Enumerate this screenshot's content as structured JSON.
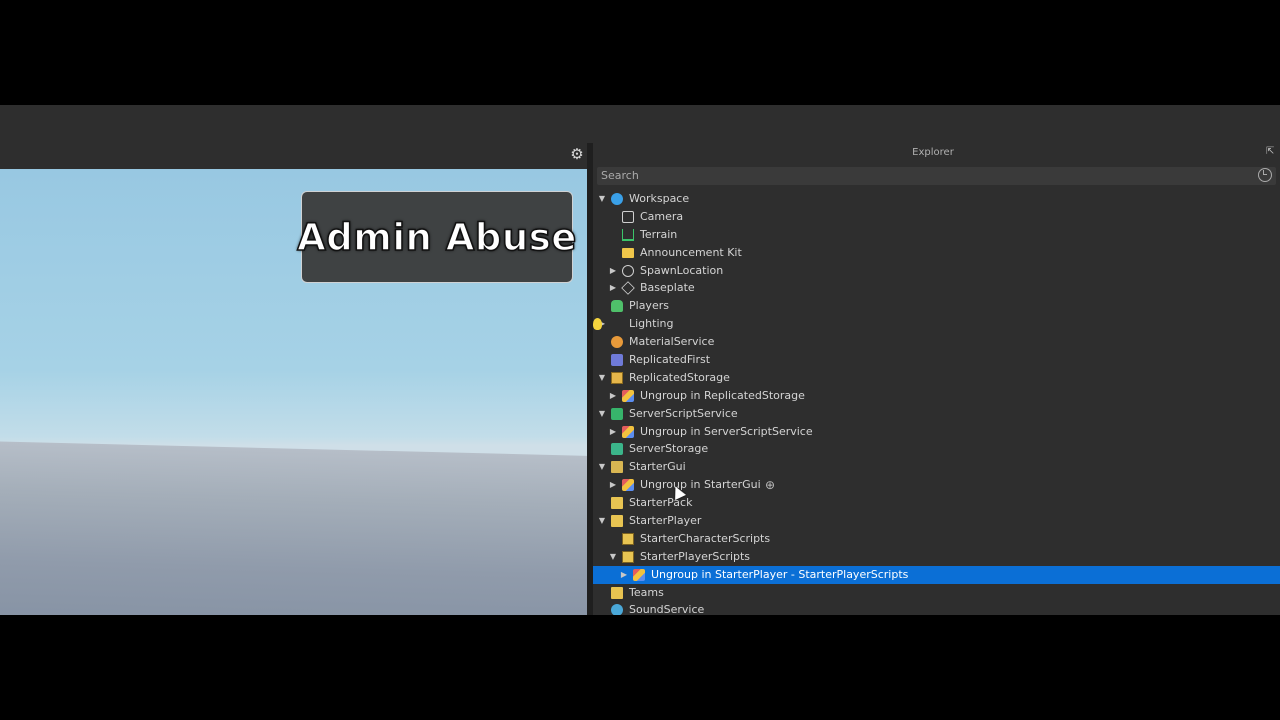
{
  "viewport": {
    "gui_text": "Admin Abuse",
    "settings_icon": "gear-icon"
  },
  "explorer": {
    "title": "Explorer",
    "search_placeholder": "Search",
    "items": [
      {
        "label": "Workspace",
        "depth": 0,
        "expanded": true,
        "icon": "workspace-icon"
      },
      {
        "label": "Camera",
        "depth": 1,
        "icon": "camera-icon"
      },
      {
        "label": "Terrain",
        "depth": 1,
        "icon": "terrain-icon"
      },
      {
        "label": "Announcement Kit",
        "depth": 1,
        "icon": "folder-icon"
      },
      {
        "label": "SpawnLocation",
        "depth": 1,
        "collapsed": true,
        "icon": "spawn-icon"
      },
      {
        "label": "Baseplate",
        "depth": 1,
        "collapsed": true,
        "icon": "part-icon"
      },
      {
        "label": "Players",
        "depth": 0,
        "icon": "players-icon"
      },
      {
        "label": "Lighting",
        "depth": 0,
        "collapsed": true,
        "icon": "lighting-icon"
      },
      {
        "label": "MaterialService",
        "depth": 0,
        "icon": "material-service-icon"
      },
      {
        "label": "ReplicatedFirst",
        "depth": 0,
        "icon": "replicated-first-icon"
      },
      {
        "label": "ReplicatedStorage",
        "depth": 0,
        "expanded": true,
        "icon": "replicated-storage-icon"
      },
      {
        "label": "Ungroup in ReplicatedStorage",
        "depth": 1,
        "collapsed": true,
        "icon": "model-icon"
      },
      {
        "label": "ServerScriptService",
        "depth": 0,
        "expanded": true,
        "icon": "server-script-service-icon"
      },
      {
        "label": "Ungroup in ServerScriptService",
        "depth": 1,
        "collapsed": true,
        "icon": "model-icon"
      },
      {
        "label": "ServerStorage",
        "depth": 0,
        "icon": "server-storage-icon"
      },
      {
        "label": "StarterGui",
        "depth": 0,
        "expanded": true,
        "icon": "starter-gui-icon"
      },
      {
        "label": "Ungroup in StarterGui",
        "depth": 1,
        "collapsed": true,
        "icon": "model-icon",
        "hover_add": true
      },
      {
        "label": "StarterPack",
        "depth": 0,
        "icon": "starter-pack-icon"
      },
      {
        "label": "StarterPlayer",
        "depth": 0,
        "expanded": true,
        "icon": "starter-player-icon"
      },
      {
        "label": "StarterCharacterScripts",
        "depth": 1,
        "icon": "starter-scripts-icon"
      },
      {
        "label": "StarterPlayerScripts",
        "depth": 1,
        "expanded": true,
        "icon": "starter-scripts-icon"
      },
      {
        "label": "Ungroup in StarterPlayer - StarterPlayerScripts",
        "depth": 2,
        "collapsed": true,
        "icon": "model-icon",
        "selected": true
      },
      {
        "label": "Teams",
        "depth": 0,
        "icon": "teams-icon"
      },
      {
        "label": "SoundService",
        "depth": 0,
        "icon": "sound-service-icon"
      }
    ]
  },
  "colors": {
    "selection": "#0b6fd6",
    "panel": "#2e2e2e"
  }
}
